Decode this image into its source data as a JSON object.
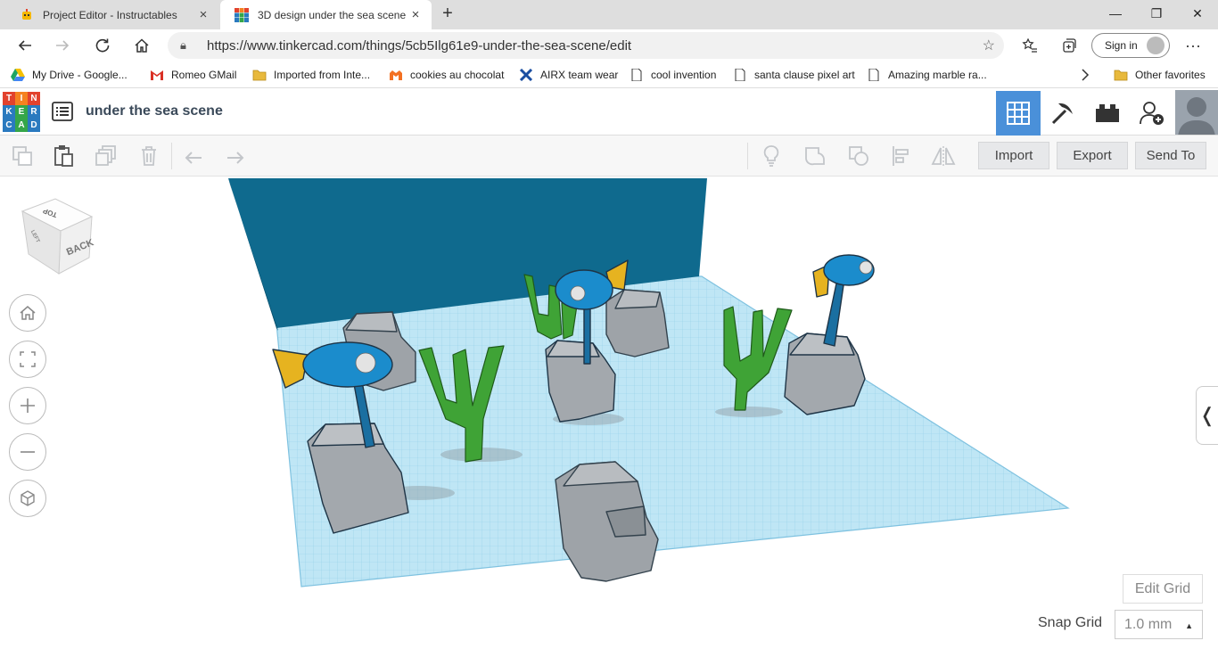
{
  "browser": {
    "tabs": [
      {
        "title": "Project Editor - Instructables",
        "icon": "instructables-robot-icon"
      },
      {
        "title": "3D design under the sea scene |",
        "icon": "tinkercad-grid-icon"
      }
    ],
    "new_tab": "+",
    "window_controls": {
      "minimize": "—",
      "maximize": "❐",
      "close": "✕"
    },
    "url": "https://www.tinkercad.com/things/5cb5Ilg61e9-under-the-sea-scene/edit",
    "sign_in": "Sign in",
    "more": "···"
  },
  "bookmarks": [
    {
      "label": "My Drive - Google...",
      "icon": "google-drive-icon"
    },
    {
      "label": "Romeo  GMail",
      "icon": "gmail-icon"
    },
    {
      "label": "Imported from Inte...",
      "icon": "folder-icon"
    },
    {
      "label": "cookies au chocolat",
      "icon": "marmiton-icon"
    },
    {
      "label": "AIRX team wear",
      "icon": "airx-icon"
    },
    {
      "label": "cool invention",
      "icon": "page-icon"
    },
    {
      "label": "santa clause pixel art",
      "icon": "page-icon"
    },
    {
      "label": "Amazing marble ra...",
      "icon": "page-icon"
    },
    {
      "label": "Other favorites",
      "icon": "folder-icon"
    }
  ],
  "app": {
    "logo_letters": [
      "T",
      "I",
      "N",
      "K",
      "E",
      "R",
      "C",
      "A",
      "D"
    ],
    "logo_colors": [
      "#e2422d",
      "#f58220",
      "#e2422d",
      "#2a7abf",
      "#35a649",
      "#2a7abf",
      "#2a7abf",
      "#35a649",
      "#2a7abf"
    ],
    "project_title": "under the sea scene",
    "header_views": [
      "3d-design-grid-icon",
      "pickaxe-icon",
      "brick-icon",
      "add-user-icon"
    ],
    "active_color": "#4a90d9"
  },
  "toolbar": {
    "import": "Import",
    "export": "Export",
    "send_to": "Send To"
  },
  "viewcube": {
    "top": "TOP",
    "back": "BACK",
    "left": "LEFT"
  },
  "workplane": {
    "edit_grid": "Edit Grid",
    "snap_grid_label": "Snap Grid",
    "snap_grid_value": "1.0 mm",
    "grid_color": "#a9dbef",
    "backdrop_color": "#0f6a8e"
  }
}
